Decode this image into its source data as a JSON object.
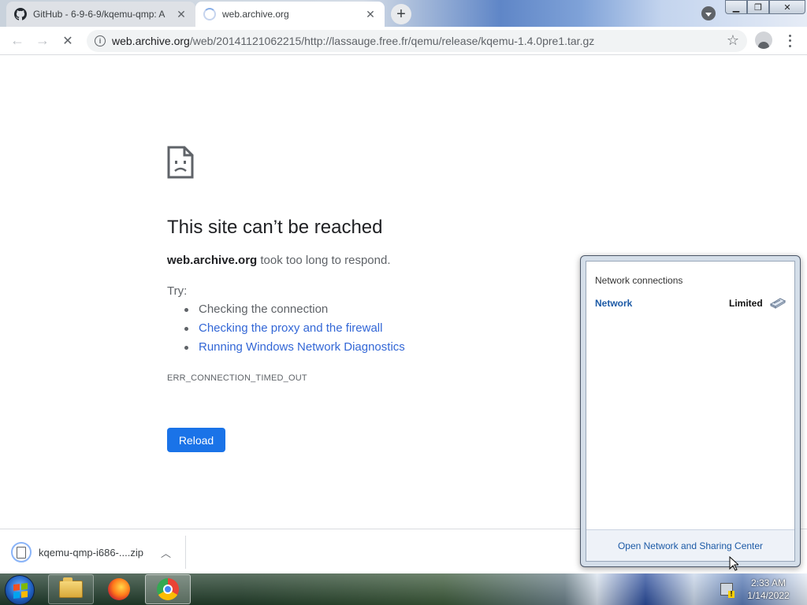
{
  "tabs": [
    {
      "title": "GitHub - 6-9-6-9/kqemu-qmp: A",
      "icon": "github-icon"
    },
    {
      "title": "web.archive.org",
      "icon": "loading-spinner-icon"
    }
  ],
  "toolbar": {
    "url_host": "web.archive.org",
    "url_path": "/web/20141121062215/http://lassauge.free.fr/qemu/release/kqemu-1.4.0pre1.tar.gz"
  },
  "error": {
    "title": "This site can’t be reached",
    "host": "web.archive.org",
    "desc_suffix": " took too long to respond.",
    "try_label": "Try:",
    "suggestions": [
      "Checking the connection",
      "Checking the proxy and the firewall",
      "Running Windows Network Diagnostics"
    ],
    "code": "ERR_CONNECTION_TIMED_OUT",
    "reload_label": "Reload"
  },
  "download": {
    "filename": "kqemu-qmp-i686-....zip"
  },
  "network_popup": {
    "header": "Network connections",
    "network_name": "Network",
    "status": "Limited",
    "footer_link": "Open Network and Sharing Center"
  },
  "taskbar": {
    "time": "2:33 AM",
    "date": "1/14/2022"
  },
  "colors": {
    "accent": "#1a73e8",
    "link": "#3367d6",
    "win_link": "#1c5aa6"
  }
}
